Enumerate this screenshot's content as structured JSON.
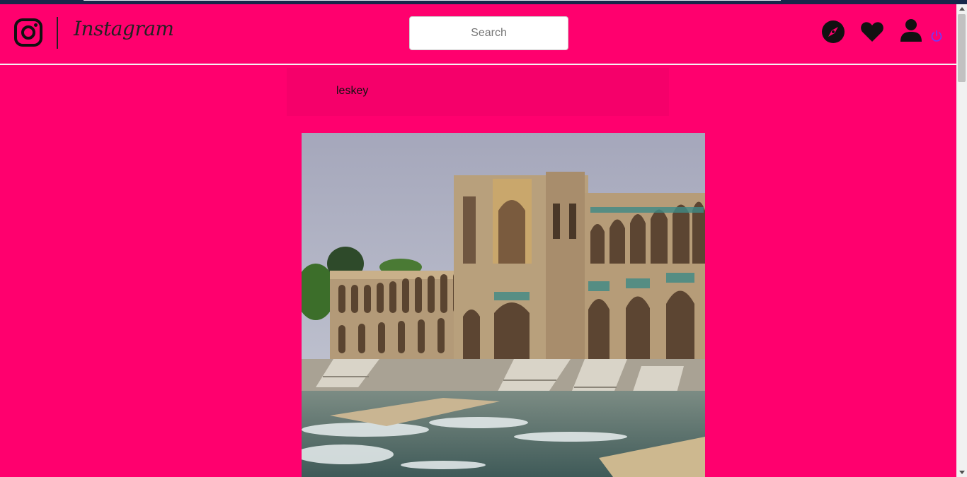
{
  "header": {
    "wordmark": "Instagram",
    "search": {
      "placeholder": "Search",
      "value": ""
    },
    "icons": [
      "instagram-logo-icon",
      "compass-icon",
      "heart-icon",
      "user-icon",
      "power-icon"
    ]
  },
  "post": {
    "username": "leskey",
    "image_subject": "historic arched bridge over river"
  },
  "colors": {
    "background": "#ff006e",
    "post_header": "#f5006a",
    "icon": "#111111",
    "power_icon": "#6a3cff"
  }
}
